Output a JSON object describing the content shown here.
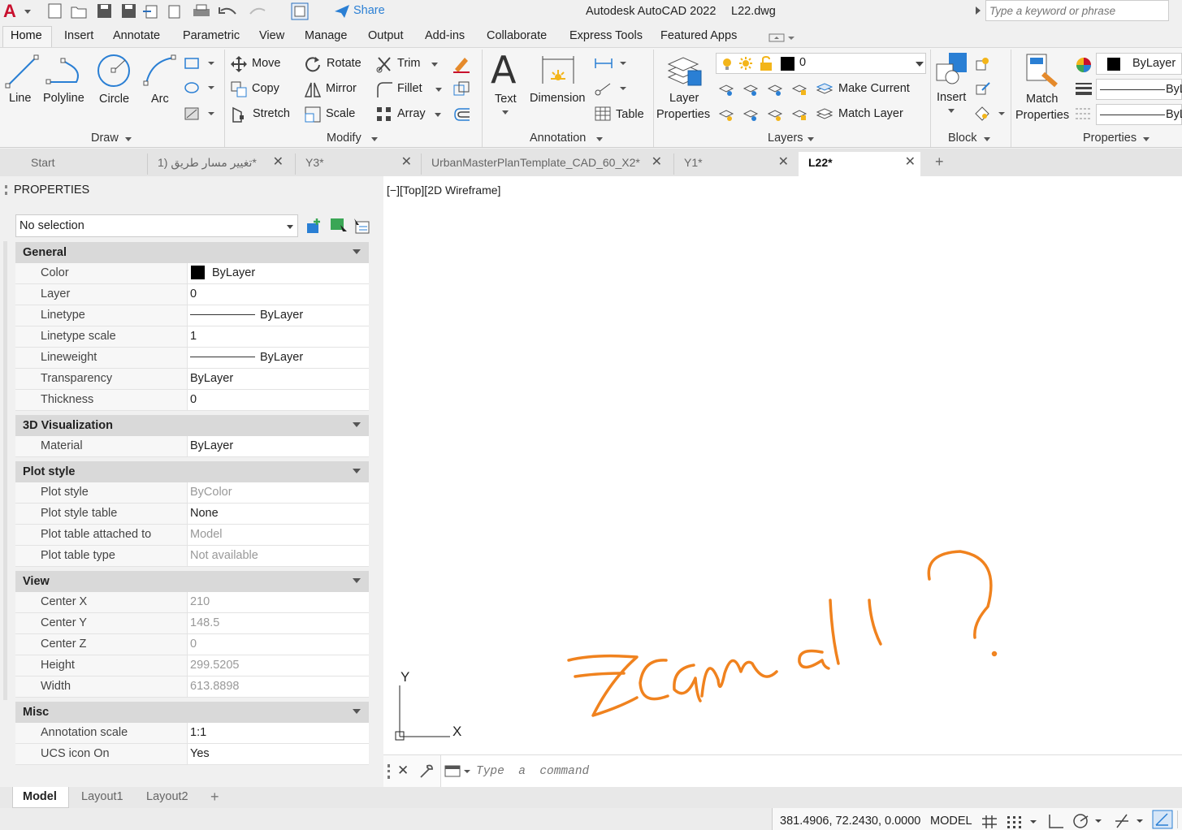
{
  "app": {
    "title": "Autodesk AutoCAD 2022",
    "file": "L22.dwg",
    "share_label": "Share",
    "search_placeholder": "Type a keyword or phrase"
  },
  "ribbon_tabs": [
    "Home",
    "Insert",
    "Annotate",
    "Parametric",
    "View",
    "Manage",
    "Output",
    "Add-ins",
    "Collaborate",
    "Express Tools",
    "Featured Apps"
  ],
  "ribbon": {
    "draw": {
      "line": "Line",
      "polyline": "Polyline",
      "circle": "Circle",
      "arc": "Arc",
      "panel": "Draw"
    },
    "modify": {
      "move": "Move",
      "rotate": "Rotate",
      "trim": "Trim",
      "copy": "Copy",
      "mirror": "Mirror",
      "fillet": "Fillet",
      "stretch": "Stretch",
      "scale": "Scale",
      "array": "Array",
      "panel": "Modify"
    },
    "annotation": {
      "text": "Text",
      "dimension": "Dimension",
      "table": "Table",
      "panel": "Annotation"
    },
    "layers": {
      "layer_properties_1": "Layer",
      "layer_properties_2": "Properties",
      "current_layer": "0",
      "make_current": "Make Current",
      "match_layer": "Match Layer",
      "panel": "Layers"
    },
    "block": {
      "insert": "Insert",
      "panel": "Block"
    },
    "properties": {
      "match_1": "Match",
      "match_2": "Properties",
      "color": "ByLayer",
      "line1": "ByL",
      "line2": "ByL",
      "panel": "Properties"
    }
  },
  "doc_tabs": [
    {
      "label": "Start",
      "active": false
    },
    {
      "label": "تغيير مسار طريق (1*",
      "active": false
    },
    {
      "label": "Y3*",
      "active": false
    },
    {
      "label": "UrbanMasterPlanTemplate_CAD_60_X2*",
      "active": false
    },
    {
      "label": "Y1*",
      "active": false
    },
    {
      "label": "L22*",
      "active": true
    }
  ],
  "properties_panel": {
    "title": "PROPERTIES",
    "selection": "No selection",
    "sections": [
      {
        "name": "General",
        "rows": [
          {
            "k": "Color",
            "v": "ByLayer",
            "swatch": "#000000"
          },
          {
            "k": "Layer",
            "v": "0"
          },
          {
            "k": "Linetype",
            "v": "ByLayer",
            "line": true
          },
          {
            "k": "Linetype scale",
            "v": "1"
          },
          {
            "k": "Lineweight",
            "v": "ByLayer",
            "line": true
          },
          {
            "k": "Transparency",
            "v": "ByLayer"
          },
          {
            "k": "Thickness",
            "v": "0"
          }
        ]
      },
      {
        "name": "3D Visualization",
        "rows": [
          {
            "k": "Material",
            "v": "ByLayer"
          }
        ]
      },
      {
        "name": "Plot style",
        "rows": [
          {
            "k": "Plot style",
            "v": "ByColor",
            "ro": true
          },
          {
            "k": "Plot style table",
            "v": "None"
          },
          {
            "k": "Plot table attached to",
            "v": "Model",
            "ro": true
          },
          {
            "k": "Plot table type",
            "v": "Not available",
            "ro": true
          }
        ]
      },
      {
        "name": "View",
        "rows": [
          {
            "k": "Center X",
            "v": "210",
            "ro": true
          },
          {
            "k": "Center Y",
            "v": "148.5",
            "ro": true
          },
          {
            "k": "Center Z",
            "v": "0",
            "ro": true
          },
          {
            "k": "Height",
            "v": "299.5205",
            "ro": true
          },
          {
            "k": "Width",
            "v": "613.8898",
            "ro": true
          }
        ]
      },
      {
        "name": "Misc",
        "rows": [
          {
            "k": "Annotation scale",
            "v": "1:1"
          },
          {
            "k": "UCS icon On",
            "v": "Yes"
          }
        ]
      }
    ]
  },
  "viewport": {
    "label": "[−][Top][2D Wireframe]",
    "ucs_y": "Y",
    "ucs_x": "X",
    "stroke_color": "#f0821e"
  },
  "command": {
    "placeholder": "Type  a  command"
  },
  "layout_tabs": [
    "Model",
    "Layout1",
    "Layout2"
  ],
  "status": {
    "coords": "381.4906, 72.2430, 0.0000",
    "space": "MODEL"
  }
}
